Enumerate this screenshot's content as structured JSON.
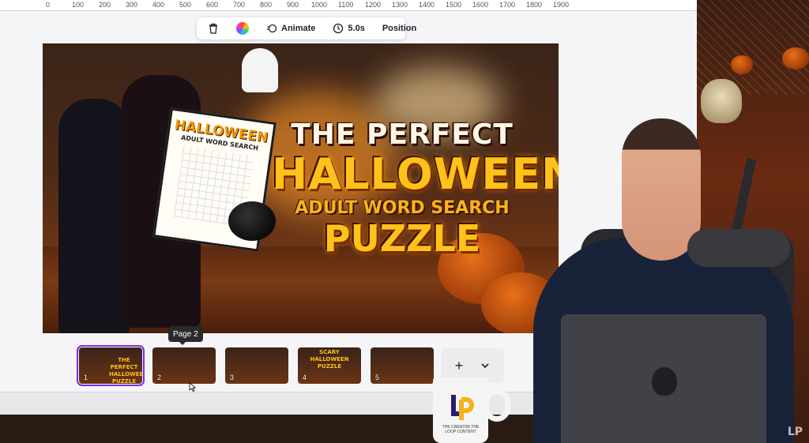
{
  "ruler": {
    "ticks": [
      "0",
      "100",
      "200",
      "300",
      "400",
      "500",
      "600",
      "700",
      "800",
      "900",
      "1000",
      "1100",
      "1200",
      "1300",
      "1400",
      "1500",
      "1600",
      "1700",
      "1800",
      "1900"
    ]
  },
  "toolbar": {
    "delete_icon": "trash-icon",
    "color_icon": "color-wheel-icon",
    "animate_label": "Animate",
    "duration_label": "5.0s",
    "position_label": "Position"
  },
  "slide": {
    "title_line1": "THE PERFECT",
    "title_line2": "HALLOWEEN",
    "title_line3": "ADULT WORD SEARCH",
    "title_line4": "PUZZLE",
    "poster_title": "HALLOWEEN",
    "poster_sub": "ADULT WORD SEARCH"
  },
  "pages": {
    "tooltip": "Page 2",
    "thumbs": [
      {
        "num": "1",
        "mini": "THE PERFECT HALLOWEEN PUZZLE",
        "selected": true
      },
      {
        "num": "2",
        "mini": "",
        "selected": false
      },
      {
        "num": "3",
        "mini": "",
        "selected": false
      },
      {
        "num": "4",
        "mini": "SCARY HALLOWEEN PUZZLE",
        "selected": false
      },
      {
        "num": "5",
        "mini": "",
        "selected": false
      }
    ],
    "add_label": "+",
    "expand_icon": "chevron-down-icon"
  },
  "mug": {
    "logo": "LP",
    "text": "THE CREATOR THE LOOP CONTENT"
  },
  "watermark": "LP",
  "colors": {
    "accent": "#7d2ae8",
    "title_gold": "#ffc21a"
  }
}
